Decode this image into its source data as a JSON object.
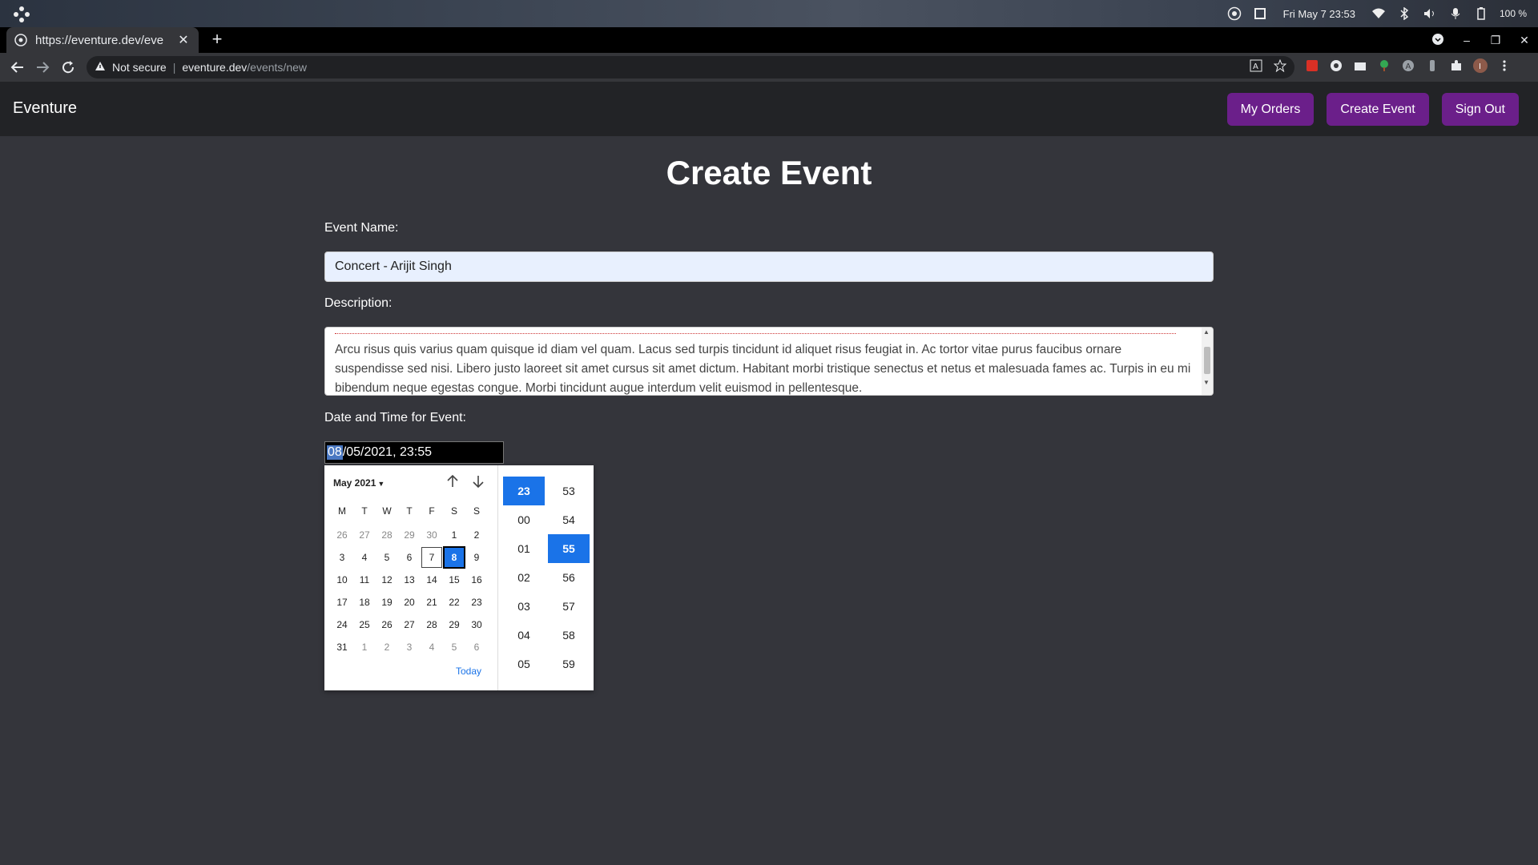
{
  "os": {
    "clock": "Fri May 7  23:53",
    "battery": "100 %"
  },
  "browser": {
    "tab_title": "https://eventure.dev/eve",
    "new_tab": "+",
    "security_label": "Not secure",
    "url_host": "eventure.dev",
    "url_path": "/events/new"
  },
  "navbar": {
    "brand": "Eventure",
    "buttons": [
      "My Orders",
      "Create Event",
      "Sign Out"
    ]
  },
  "form": {
    "title": "Create Event",
    "name_label": "Event Name:",
    "name_value": "Concert - Arijit Singh",
    "desc_label": "Description:",
    "desc_line1": "Arcu risus quis varius quam quisque id diam vel quam. Lacus sed turpis tincidunt id aliquet risus feugiat in. Ac tortor vitae purus faucibus ornare",
    "desc_line2": "suspendisse sed nisi. Libero justo laoreet sit amet cursus sit amet dictum. Habitant morbi tristique senectus et netus et malesuada fames ac. Turpis in eu mi",
    "desc_line3": "bibendum neque egestas congue. Morbi tincidunt augue interdum velit euismod in pellentesque.",
    "dt_label": "Date and Time for Event:",
    "dt_highlight": "08",
    "dt_rest": "/05/2021, 23:55"
  },
  "picker": {
    "month_label": "May 2021",
    "weekdays": [
      "M",
      "T",
      "W",
      "T",
      "F",
      "S",
      "S"
    ],
    "days": [
      [
        "26",
        "27",
        "28",
        "29",
        "30",
        "1",
        "2"
      ],
      [
        "3",
        "4",
        "5",
        "6",
        "7",
        "8",
        "9"
      ],
      [
        "10",
        "11",
        "12",
        "13",
        "14",
        "15",
        "16"
      ],
      [
        "17",
        "18",
        "19",
        "20",
        "21",
        "22",
        "23"
      ],
      [
        "24",
        "25",
        "26",
        "27",
        "28",
        "29",
        "30"
      ],
      [
        "31",
        "1",
        "2",
        "3",
        "4",
        "5",
        "6"
      ]
    ],
    "today_label": "Today",
    "hours": [
      "23",
      "00",
      "01",
      "02",
      "03",
      "04",
      "05"
    ],
    "minutes": [
      "53",
      "54",
      "55",
      "56",
      "57",
      "58",
      "59"
    ],
    "selected_hour": "23",
    "selected_minute": "55"
  }
}
